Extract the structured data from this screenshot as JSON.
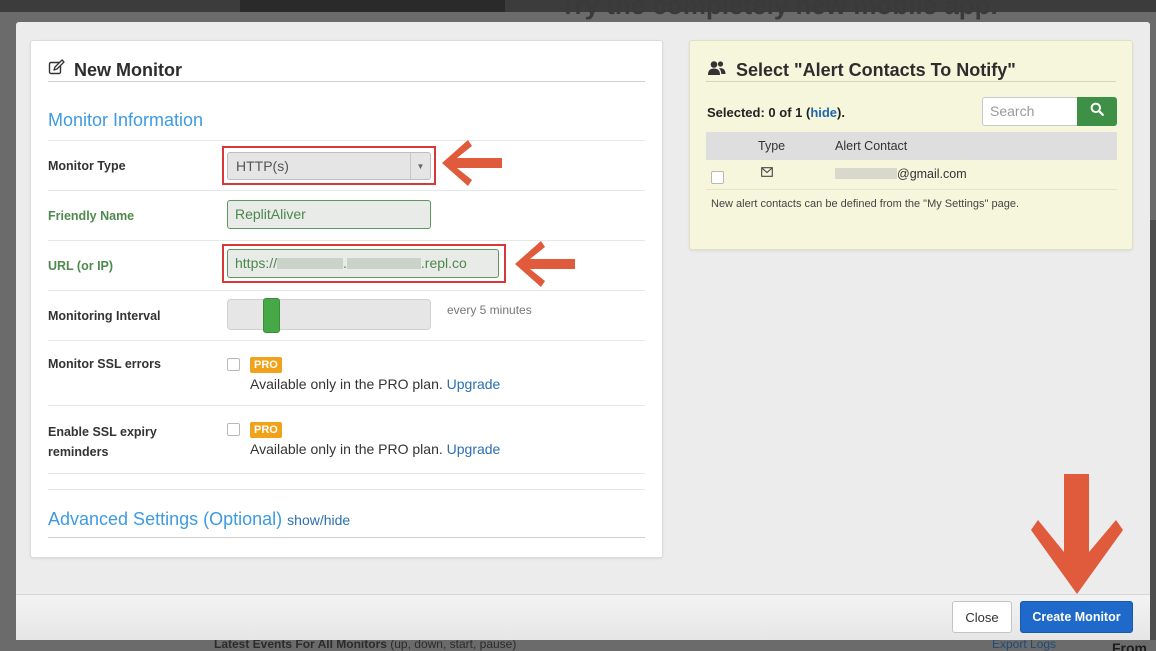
{
  "background": {
    "headline": "Try the completely new mobile app.",
    "latest_events": "Latest Events For All Monitors",
    "latest_events_sub": "(up, down, start, pause)",
    "export_logs": "Export Logs",
    "from": "From"
  },
  "monitor_panel": {
    "title": "New Monitor",
    "section_title": "Monitor Information",
    "monitor_type": {
      "label": "Monitor Type",
      "value": "HTTP(s)"
    },
    "friendly_name": {
      "label": "Friendly Name",
      "value": "ReplitAliver"
    },
    "url": {
      "label": "URL (or IP)",
      "prefix": "https://",
      "dot": ".",
      "suffix": ".repl.co"
    },
    "interval": {
      "label": "Monitoring Interval",
      "value_text": "every 5 minutes",
      "level_fraction": 0.19
    },
    "ssl_errors": {
      "label": "Monitor SSL errors",
      "badge": "PRO",
      "note": "Available only in the PRO plan.",
      "link": "Upgrade"
    },
    "ssl_expiry": {
      "label_line1": "Enable SSL expiry",
      "label_line2": "reminders",
      "badge": "PRO",
      "note": "Available only in the PRO plan.",
      "link": "Upgrade"
    },
    "advanced": {
      "title": "Advanced Settings (Optional)",
      "toggle": "show/hide"
    }
  },
  "contacts_panel": {
    "title": "Select \"Alert Contacts To Notify\"",
    "selected_prefix": "Selected: 0 of 1 (",
    "hide_link": "hide",
    "selected_suffix": ").",
    "search_placeholder": "Search",
    "columns": [
      "Type",
      "Alert Contact"
    ],
    "rows": [
      {
        "contact_suffix": "@gmail.com"
      }
    ],
    "note": "New alert contacts can be defined from the \"My Settings\" page."
  },
  "footer": {
    "close_label": "Close",
    "create_label": "Create Monitor"
  },
  "colors": {
    "accent_blue": "#3d9be0",
    "create_button": "#1e69c9",
    "search_button": "#3d9045",
    "pro_badge": "#f0a21a",
    "highlight_box": "#d9383a",
    "annotation_arrow": "#e05b3c"
  },
  "icons": [
    "edit-icon",
    "users-icon",
    "search-icon",
    "chevron-down-icon",
    "envelope-icon"
  ]
}
